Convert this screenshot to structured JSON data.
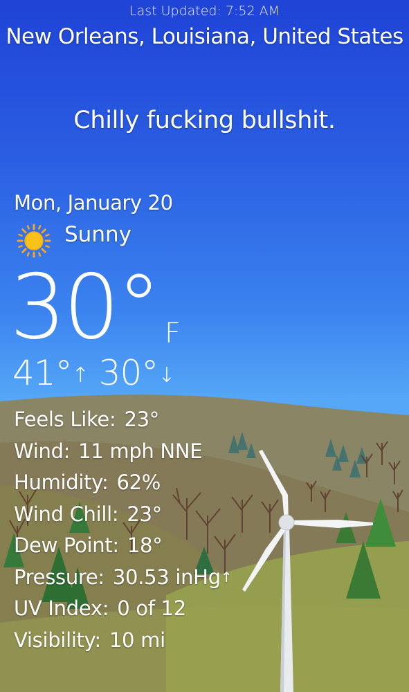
{
  "header": {
    "last_updated": "Last Updated: 7:52 AM",
    "location": "New Orleans, Louisiana, United States"
  },
  "headline": "Chilly fucking bullshit.",
  "current": {
    "date": "Mon, January 20",
    "condition": "Sunny",
    "condition_icon": "sun-icon",
    "temperature": "30°",
    "unit": "F",
    "high": "41°",
    "high_arrow": "↑",
    "low": "30°",
    "low_arrow": "↓"
  },
  "details": [
    {
      "label": "Feels Like:",
      "value": "23°"
    },
    {
      "label": "Wind:",
      "value": "11 mph NNE"
    },
    {
      "label": "Humidity:",
      "value": "62%"
    },
    {
      "label": "Wind Chill:",
      "value": "23°"
    },
    {
      "label": "Dew Point:",
      "value": "18°"
    },
    {
      "label": "Pressure:",
      "value": "30.53 inHg",
      "trend": "↑"
    },
    {
      "label": "UV Index:",
      "value": "0 of 12"
    },
    {
      "label": "Visibility:",
      "value": "10 mi"
    }
  ],
  "colors": {
    "sky_top": "#1f43d6",
    "sky_bottom": "#62b2fa",
    "hill_far": "#8a8a5a",
    "hill_near": "#8f9a4a",
    "tree_green": "#2f7a3a",
    "sun_fill": "#f9c21b"
  }
}
